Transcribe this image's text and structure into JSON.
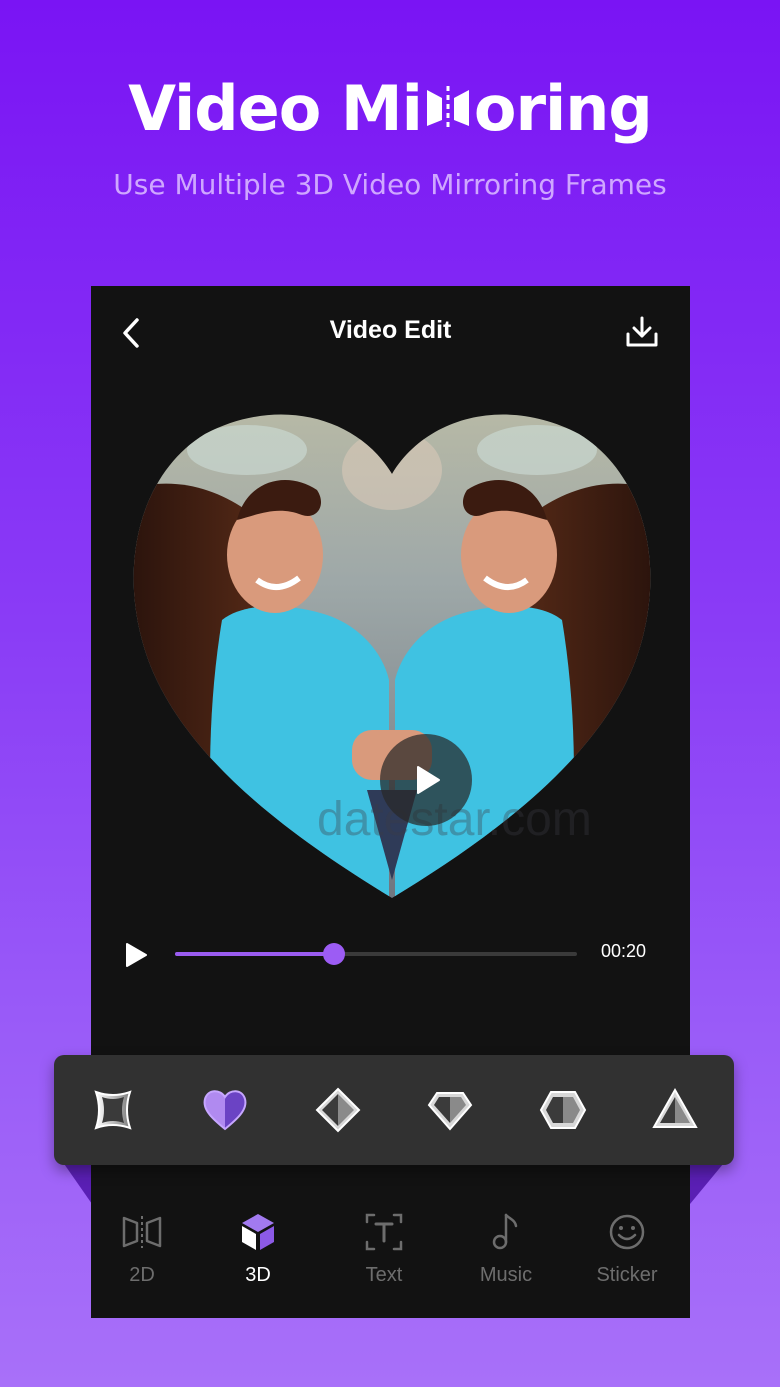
{
  "promo": {
    "headline_before": "Video Mi",
    "headline_after": "oring",
    "subtitle": "Use Multiple 3D Video Mirroring Frames"
  },
  "editor": {
    "title": "Video Edit",
    "icons": {
      "back": "chevron-left-icon",
      "download": "download-icon",
      "play": "play-icon"
    },
    "watermark": "datestar.com",
    "player": {
      "time": "00:20",
      "progress": 0.395
    }
  },
  "frames": {
    "selected_index": 1,
    "items": [
      {
        "name": "square-frame-icon"
      },
      {
        "name": "heart-frame-icon"
      },
      {
        "name": "diamond-frame-icon"
      },
      {
        "name": "gem-frame-icon"
      },
      {
        "name": "hexagon-frame-icon"
      },
      {
        "name": "triangle-frame-icon"
      }
    ]
  },
  "tabs": {
    "active_index": 1,
    "items": [
      {
        "label": "2D",
        "icon": "mirror-2d-icon"
      },
      {
        "label": "3D",
        "icon": "cube-3d-icon"
      },
      {
        "label": "Text",
        "icon": "text-icon"
      },
      {
        "label": "Music",
        "icon": "music-note-icon"
      },
      {
        "label": "Sticker",
        "icon": "smiley-sticker-icon"
      }
    ]
  },
  "colors": {
    "accent": "#9c5cf4",
    "background_top": "#7a14f4",
    "background_bottom": "#a870f9",
    "panel": "#121212",
    "frame_strip": "#313131"
  }
}
